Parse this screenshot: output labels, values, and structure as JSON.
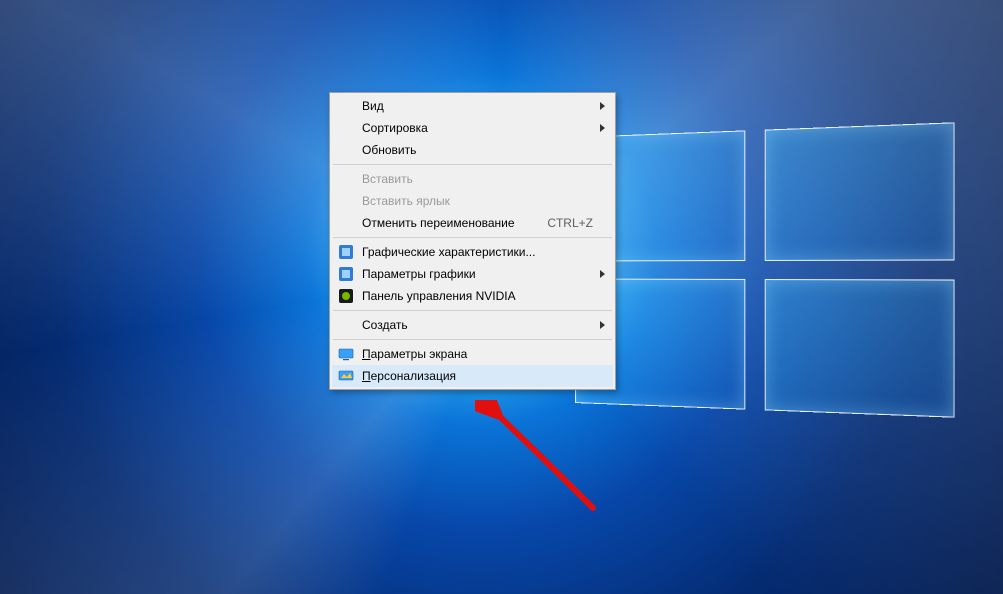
{
  "menu": {
    "view": {
      "label": "Вид"
    },
    "sort": {
      "label": "Сортировка"
    },
    "refresh": {
      "label": "Обновить"
    },
    "paste": {
      "label": "Вставить"
    },
    "paste_shortcut": {
      "label": "Вставить ярлык"
    },
    "undo_rename": {
      "label": "Отменить переименование",
      "shortcut": "CTRL+Z"
    },
    "gfx_props": {
      "label": "Графические характеристики..."
    },
    "gfx_params": {
      "label": "Параметры графики"
    },
    "nvidia_cp": {
      "label": "Панель управления NVIDIA"
    },
    "create": {
      "label": "Создать"
    },
    "display_params": {
      "label": "Параметры экрана",
      "mnemonic": "П"
    },
    "personalization": {
      "label": "Персонализация",
      "mnemonic": "П"
    }
  }
}
